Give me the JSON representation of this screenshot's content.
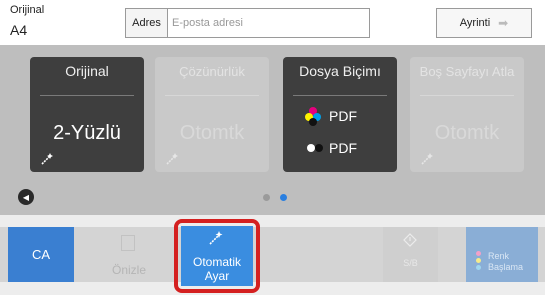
{
  "header": {
    "original_label": "Orijinal",
    "original_value": "A4",
    "address_label": "Adres",
    "address_placeholder": "E-posta adresi",
    "details_label": "Ayrinti"
  },
  "tiles": [
    {
      "title": "Orijinal",
      "value": "2-Yüzlü",
      "state": "active"
    },
    {
      "title": "Çözünürlük",
      "value": "Otomtk",
      "state": "disabled"
    },
    {
      "title": "Dosya Biçimı",
      "values": [
        "PDF",
        "PDF"
      ],
      "state": "active"
    },
    {
      "title": "Boş Sayfayı Atla",
      "value": "Otomtk",
      "state": "disabled"
    }
  ],
  "pager": {
    "pages": 2,
    "current": 2
  },
  "bottom": {
    "ca_label": "CA",
    "preview_label": "Önizle",
    "auto_label": "Otomatik Ayar",
    "bw_label": "S/B",
    "color_label": "Renk Başlama"
  },
  "colors": {
    "accent_blue": "#3a8de0",
    "highlight_red": "#d42020",
    "tile_active": "#3e3e3e",
    "main_bg": "#bebebe"
  }
}
